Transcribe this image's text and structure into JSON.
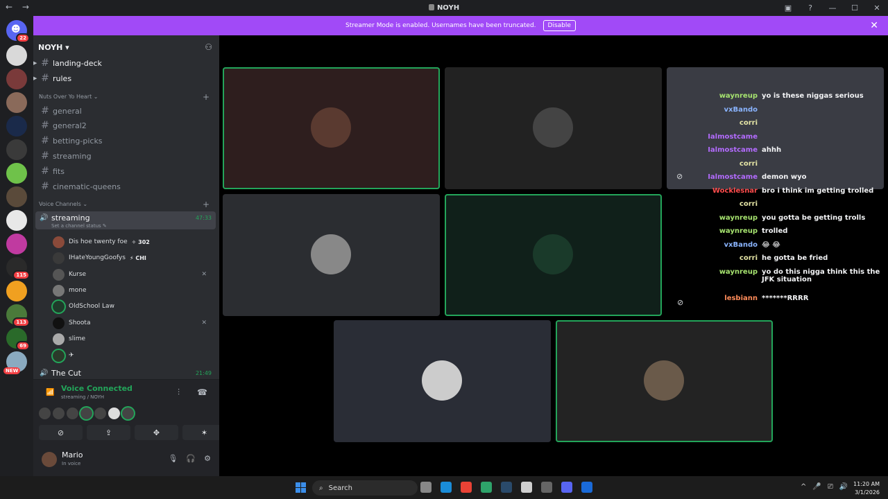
{
  "window": {
    "title": "NOYH",
    "nav_back": "←",
    "nav_fwd": "→",
    "inbox_icon": "inbox-icon",
    "help_icon": "help-icon",
    "minimize": "—",
    "maximize": "☐",
    "close": "✕"
  },
  "banner": {
    "text": "Streamer Mode is enabled. Usernames have been truncated.",
    "button": "Disable",
    "close": "✕",
    "color": "#a14af7"
  },
  "servers": {
    "home_badge": "22",
    "badges": [
      "115",
      "113",
      "69"
    ],
    "new_label": "NEW"
  },
  "server": {
    "name": "NOYH ▾",
    "add_member_icon": "add-member-icon"
  },
  "channels_top": [
    {
      "name": "landing-deck"
    },
    {
      "name": "rules"
    }
  ],
  "category": "Nuts Over Yo Heart ⌄",
  "channels": [
    {
      "name": "general"
    },
    {
      "name": "general2"
    },
    {
      "name": "betting-picks"
    },
    {
      "name": "streaming"
    },
    {
      "name": "fits"
    },
    {
      "name": "cinematic-queens"
    }
  ],
  "voice_category": "Voice Channels ⌄",
  "voice_channel": {
    "name": "streaming",
    "status": "Set a channel status ✎",
    "time": "47:33"
  },
  "voice_users": [
    {
      "name": "Dis hoe twenty foe",
      "tag": "✧ 302",
      "muted": ""
    },
    {
      "name": "IHateYoungGoofys",
      "tag": "⚡ CHI",
      "muted": ""
    },
    {
      "name": "Kurse",
      "tag": "",
      "muted": "✕"
    },
    {
      "name": "mone",
      "tag": "",
      "muted": ""
    },
    {
      "name": "OldSchool Law",
      "tag": "",
      "muted": ""
    },
    {
      "name": "Shoota",
      "tag": "",
      "muted": "✕"
    },
    {
      "name": "slime",
      "tag": "",
      "muted": ""
    },
    {
      "name": "✈",
      "tag": "",
      "muted": ""
    }
  ],
  "voice_channel2": {
    "name": "The Cut",
    "time": "21:49"
  },
  "voice_panel": {
    "status": "Voice Connected",
    "sub": "streaming / NOYH",
    "buttons": [
      "⊘",
      "⇪",
      "✥",
      "✶"
    ]
  },
  "user": {
    "name": "Mario",
    "status": "In voice"
  },
  "chat": [
    {
      "user": "waynreup",
      "text": "yo is these niggas serious",
      "color": "#a6e36f"
    },
    {
      "user": "vxBando",
      "text": "",
      "color": "#8ab4ff"
    },
    {
      "user": "corri",
      "text": "",
      "color": "#e6e6a6"
    },
    {
      "user": "Ialmostcame",
      "text": "",
      "color": "#b36bff"
    },
    {
      "user": "Ialmostcame",
      "text": "ahhh",
      "color": "#b36bff"
    },
    {
      "user": "corri",
      "text": "",
      "color": "#e6e6a6"
    },
    {
      "user": "Ialmostcame",
      "text": "demon wyo",
      "color": "#b36bff"
    },
    {
      "user": "Wocklesnar",
      "text": "bro i think im getting trolled",
      "color": "#ff4d4d"
    },
    {
      "user": "corri",
      "text": "",
      "color": "#e6e6a6"
    },
    {
      "user": "waynreup",
      "text": "you gotta be getting trolls",
      "color": "#a6e36f"
    },
    {
      "user": "waynreup",
      "text": "trolled",
      "color": "#a6e36f"
    },
    {
      "user": "vxBando",
      "text": "😂 😂",
      "color": "#8ab4ff"
    },
    {
      "user": "corri",
      "text": "he gotta be fried",
      "color": "#e6e6a6"
    },
    {
      "user": "waynreup",
      "text": "yo do this nigga think this the JFK situation",
      "color": "#a6e36f"
    },
    {
      "user": "lesbiann",
      "text": "*******RRRR",
      "color": "#ff8c5a"
    }
  ],
  "taskbar": {
    "search": "Search",
    "tray": [
      "^",
      "🎤",
      "⎚",
      "🔊"
    ],
    "time": "11:20 AM",
    "date": "3/1/2026"
  }
}
